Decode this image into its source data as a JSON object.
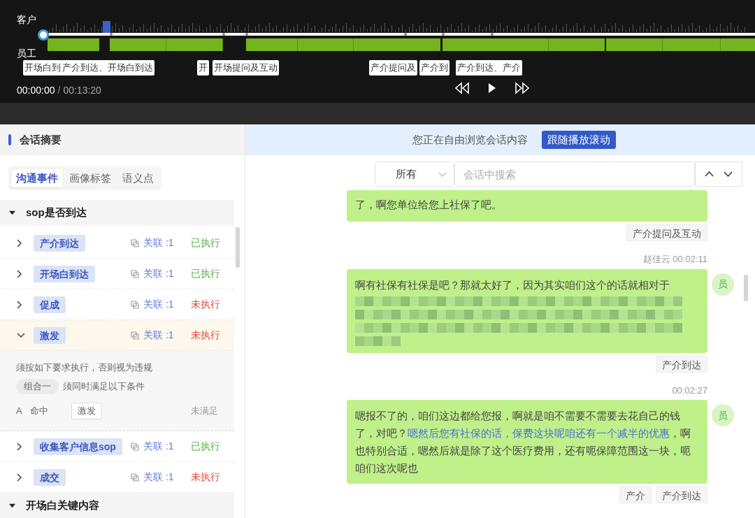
{
  "player": {
    "speakers": [
      "客户",
      "员工"
    ],
    "markers": [
      {
        "label": "开场白到"
      },
      {
        "label": "产介到达、开场白到达"
      },
      {
        "label": "开"
      },
      {
        "label": "开场提问及互动"
      },
      {
        "label": "产介提问及"
      },
      {
        "label": "产介到"
      },
      {
        "label": "产介到达、产介"
      }
    ],
    "current_time": "00:00:00",
    "separator": "/",
    "total_time": "00:13:20"
  },
  "summary": {
    "title": "会话摘要",
    "tabs": [
      {
        "label": "沟通事件",
        "selected": true
      },
      {
        "label": "画像标签",
        "selected": false
      },
      {
        "label": "语义点",
        "selected": false
      }
    ],
    "groups": [
      {
        "title": "sop是否到达",
        "expanded": true,
        "items": [
          {
            "tag": "产介到达",
            "link": "关联 :1",
            "status": "已执行",
            "executed": true,
            "expanded": false
          },
          {
            "tag": "开场白到达",
            "link": "关联 :1",
            "status": "已执行",
            "executed": true,
            "expanded": false
          },
          {
            "tag": "促成",
            "link": "关联 :1",
            "status": "未执行",
            "executed": false,
            "expanded": false
          },
          {
            "tag": "激发",
            "link": "关联 :1",
            "status": "未执行",
            "executed": false,
            "expanded": true,
            "detail": {
              "rule": "须按如下要求执行，否则视为违规",
              "combo": "组合一",
              "combo_text": "须同时满足以下条件",
              "letter": "A",
              "verb": "命中",
              "keyword": "激发",
              "result": "未满足"
            }
          },
          {
            "tag": "收集客户信息sop",
            "link": "关联 :1",
            "status": "已执行",
            "executed": true,
            "expanded": false
          },
          {
            "tag": "成交",
            "link": "关联 :1",
            "status": "未执行",
            "executed": false,
            "expanded": false
          }
        ]
      },
      {
        "title": "开场白关键内容",
        "expanded": true
      }
    ]
  },
  "banner": {
    "text": "您正在自由浏览会话内容",
    "button": "跟随播放滚动"
  },
  "search": {
    "filter": "所有",
    "placeholder": "会话中搜索"
  },
  "messages": [
    {
      "segments": [
        {
          "text": "了，啊您单位给您上社保了吧。",
          "highlighted": false
        }
      ],
      "redacted": false,
      "tags": [
        "产介提问及互动"
      ]
    },
    {
      "meta": "赵佳云 00:02:11",
      "avatar": "员",
      "segments": [
        {
          "text": "啊有社保有社保是吧？那就太好了，因为其实咱们这个的话就相对于",
          "highlighted": false
        }
      ],
      "redacted": true,
      "tags": [
        "产介到达"
      ]
    },
    {
      "meta": "00:02:27",
      "avatar": "员",
      "segments": [
        {
          "text": "嗯报不了的，咱们这边都给您报，啊就是咱不需要不需要去花自己的钱了，对吧？",
          "highlighted": false
        },
        {
          "text": "嗯然后您有社保的话，保费这块呢咱还有一个减半的优惠",
          "highlighted": true
        },
        {
          "text": "，啊也特别合适，嗯然后就是除了这个医疗费用，还有呃保障范围这一块，呃咱们这次呢也",
          "highlighted": false
        }
      ],
      "redacted": false,
      "tags": [
        "产介",
        "产介到达"
      ]
    }
  ]
}
